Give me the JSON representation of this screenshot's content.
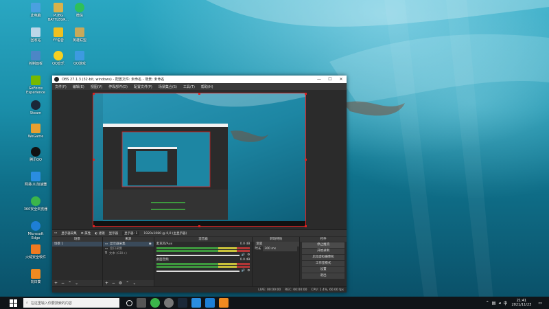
{
  "desktop": {
    "icons": [
      {
        "label": "此电脑",
        "color": "#4aa0e0"
      },
      {
        "label": "PUBG\nBATTLEGR...",
        "color": "#d8b24a"
      },
      {
        "label": "微信",
        "color": "#2ec05a"
      },
      {
        "label": "回收站",
        "color": "#bcd6e8"
      },
      {
        "label": "YY语音",
        "color": "#f0c020"
      },
      {
        "label": "英雄联盟",
        "color": "#c9a95a"
      },
      {
        "label": "控制面板",
        "color": "#4c86c6"
      },
      {
        "label": "QQ音乐",
        "color": "#f5d020"
      },
      {
        "label": "QQ游戏",
        "color": "#3d9ae0"
      },
      {
        "label": "GeForce\nExperience",
        "color": "#76b900"
      },
      {
        "label": "Steam",
        "color": "#1b2838"
      },
      {
        "label": "WeGame",
        "color": "#e8a030"
      },
      {
        "label": "腾讯QQ",
        "color": "#111111"
      },
      {
        "label": "网易UU加速器",
        "color": "#2a8de0"
      },
      {
        "label": "360安全浏览器",
        "color": "#3bb54a"
      },
      {
        "label": "Microsoft\nEdge",
        "color": "#1e7fd6"
      },
      {
        "label": "火绒安全软件",
        "color": "#f07a20"
      },
      {
        "label": "向日葵",
        "color": "#f08a20"
      }
    ]
  },
  "obs": {
    "title": "OBS 27.1.3 (32-bit, windows) - 配置文件: 未命名 - 场景: 未命名",
    "window_controls": [
      "—",
      "☐",
      "✕"
    ],
    "menu": [
      "文件(F)",
      "编辑(E)",
      "视图(V)",
      "停靠部件(D)",
      "配置文件(P)",
      "场景集合(S)",
      "工具(T)",
      "帮助(H)"
    ],
    "source_bar": [
      "显示器采集",
      "⚙ 属性",
      "◐ 滤镜",
      "显示器",
      "显示器: 1",
      "1920x1080 @ 0,0 (主显示器)"
    ],
    "docks": {
      "scenes": {
        "header": "场景",
        "items": [
          "场景 1"
        ]
      },
      "sources": {
        "header": "来源",
        "items": [
          "显示器采集",
          "窗口采集",
          "文本 (GDI+)"
        ]
      },
      "mixer": {
        "header": "混音器",
        "channels": [
          {
            "name": "麦克风/Aux",
            "db": "0.0 dB"
          },
          {
            "name": "桌面音频",
            "db": "0.0 dB"
          }
        ]
      },
      "transitions": {
        "header": "转场特效",
        "type": "渐变",
        "duration_label": "时长",
        "duration": "300 ms"
      },
      "controls": {
        "header": "控件",
        "buttons": [
          "停止推流",
          "开始录制",
          "启动虚拟摄像机",
          "工作室模式",
          "设置",
          "退出"
        ]
      }
    },
    "status": {
      "live": "LIVE: 00:00:00",
      "rec": "REC: 00:00:00",
      "cpu": "CPU: 1.4%, 60.00 fps"
    }
  },
  "taskbar": {
    "search_placeholder": "在这里输入你要搜索的内容",
    "time": "21:41",
    "date": "2021/11/23"
  }
}
